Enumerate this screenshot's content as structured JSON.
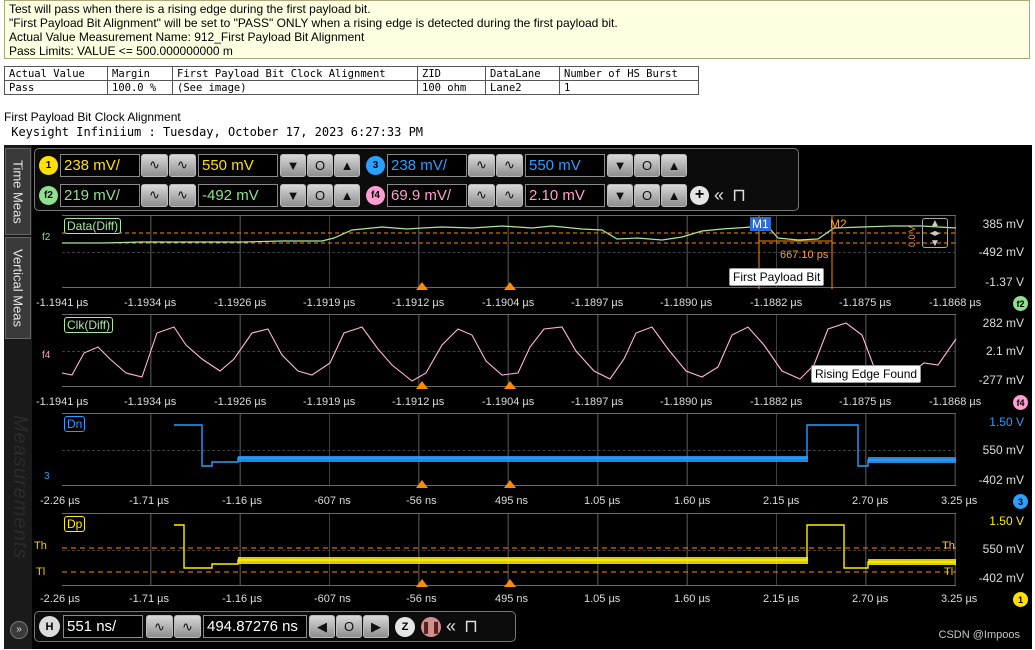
{
  "report": {
    "info_lines": [
      "Test will pass when there is a rising edge during the first payload bit.",
      "\"First Payload Bit Alignment\" will be set to \"PASS\" ONLY when a rising edge is detected during the first payload bit.",
      "Actual Value Measurement Name: 912_First Payload Bit Alignment",
      "Pass Limits: VALUE <= 500.000000000 m"
    ],
    "table": {
      "headers": [
        "Actual Value",
        "Margin",
        "First Payload Bit Clock Alignment",
        "ZID",
        "DataLane",
        "Number of HS Burst"
      ],
      "row": [
        "Pass",
        "100.0 %",
        "(See image)",
        "100 ohm",
        "Lane2",
        "1"
      ]
    },
    "image_caption": "First Payload Bit Clock Alignment",
    "scope_title": " Keysight Infiniium : Tuesday, October 17, 2023 6:27:33 PM"
  },
  "scope": {
    "side_tabs": {
      "time_meas": "Time Meas",
      "vertical_meas": "Vertical Meas",
      "watermark": "Measurements"
    },
    "channels": {
      "ch1": {
        "badge": "1",
        "scale": "238 mV/",
        "offset": "550 mV",
        "color": "#ffe000"
      },
      "ch3": {
        "badge": "3",
        "scale": "238 mV/",
        "offset": "550 mV",
        "color": "#2aa0ff"
      },
      "f2": {
        "badge": "f2",
        "scale": "219 mV/",
        "offset": "-492 mV",
        "color": "#8fe08f"
      },
      "f4": {
        "badge": "f4",
        "scale": "69.9 mV/",
        "offset": "2.10 mV",
        "color": "#ff9ed0"
      }
    },
    "waveforms": {
      "data": {
        "label": "Data(Diff)",
        "top": "385 mV",
        "mid": "-492 mV",
        "bottom": "-1.37 V",
        "color": "#a8e8a0"
      },
      "clk": {
        "label": "Clk(Diff)",
        "top": "282 mV",
        "mid": "2.1 mV",
        "bottom": "-277 mV",
        "color": "#ffb6d8"
      },
      "dn": {
        "label": "Dn",
        "top": "1.50 V",
        "mid": "550 mV",
        "bottom": "-402 mV",
        "color": "#2a9dff"
      },
      "dp": {
        "label": "Dp",
        "top": "1.50 V",
        "mid": "550 mV",
        "bottom": "-402 mV",
        "color": "#ffee00"
      }
    },
    "time_axis_fine": [
      "-1.1941 µs",
      "-1.1934 µs",
      "-1.1926 µs",
      "-1.1919 µs",
      "-1.1912 µs",
      "-1.1904 µs",
      "-1.1897 µs",
      "-1.1890 µs",
      "-1.1882 µs",
      "-1.1875 µs",
      "-1.1868 µs"
    ],
    "time_axis_coarse": [
      "-2.26 µs",
      "-1.71 µs",
      "-1.16 µs",
      "-607 ns",
      "-56 ns",
      "495 ns",
      "1.05 µs",
      "1.60 µs",
      "2.15 µs",
      "2.70 µs",
      "3.25 µs"
    ],
    "annotations": {
      "m1": "M1",
      "m2": "M2",
      "delta": "667.10 ps",
      "first_payload_bit": "First Payload Bit",
      "rising_edge_found": "Rising Edge Found",
      "th_left": "Th",
      "th_right": "Th",
      "tl_left": "Tl",
      "tl_right": "Tl",
      "ground_f2": "f2",
      "ground_f4": "f4",
      "ground_3": "3",
      "zoom_indicator": "0.0 V",
      "end_badge_1": "f2",
      "end_badge_2": "f4",
      "end_badge_3": "3",
      "end_badge_4": "1"
    },
    "horizontal": {
      "badge": "H",
      "scale": "551 ns/",
      "position": "494.87276 ns",
      "zoom_badge": "Z"
    },
    "credit": "CSDN @Impoos"
  }
}
